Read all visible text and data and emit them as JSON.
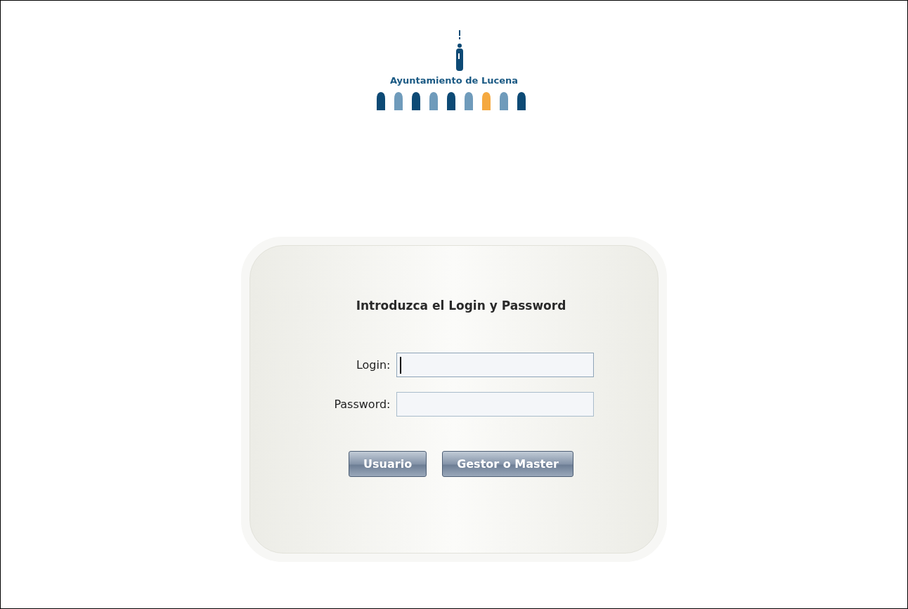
{
  "header": {
    "logo_text": "Ayuntamiento de Lucena"
  },
  "login_panel": {
    "title": "Introduzca el Login y Password",
    "fields": [
      {
        "label": "Login:",
        "focused": true
      },
      {
        "label": "Password:",
        "focused": false
      }
    ],
    "buttons": [
      "Usuario",
      "Gestor o Master"
    ]
  }
}
